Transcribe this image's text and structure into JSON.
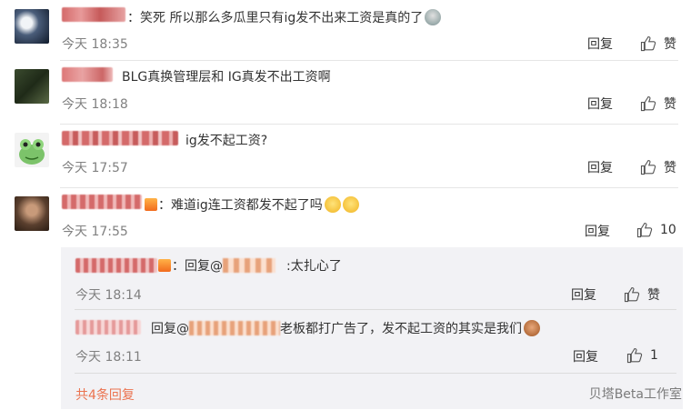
{
  "comments": [
    {
      "name": "",
      "text": "：笑死  所以那么多瓜里只有ig发不出来工资是真的了",
      "time": "今天 18:35",
      "reply": "回复",
      "like": "赞"
    },
    {
      "name": "",
      "text": "BLG真换管理层和 IG真发不出工资啊",
      "time": "今天 18:18",
      "reply": "回复",
      "like": "赞"
    },
    {
      "name": "",
      "text": "ig发不起工资?",
      "time": "今天 17:57",
      "reply": "回复",
      "like": "赞"
    },
    {
      "name": "",
      "text": "：难道ig连工资都发不起了吗",
      "time": "今天 17:55",
      "reply": "回复",
      "like": "10"
    }
  ],
  "sub_comments": [
    {
      "prefix": "：回复@",
      "text": ":太扎心了",
      "time": "今天 18:14",
      "reply": "回复",
      "like": "赞"
    },
    {
      "prefix": "回复@",
      "text": "老板都打广告了，发不起工资的其实是我们",
      "time": "今天 18:11",
      "reply": "回复",
      "like": "1"
    }
  ],
  "more_replies": "共4条回复",
  "watermark": "贝塔Beta工作室",
  "colors": {
    "accent": "#eb7350",
    "time": "#808080",
    "subbox": "#f2f2f5"
  }
}
